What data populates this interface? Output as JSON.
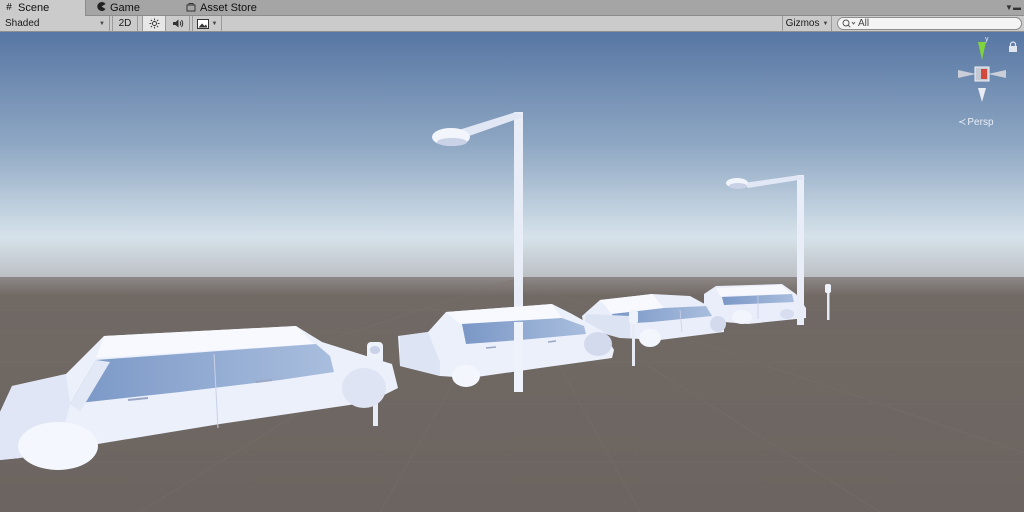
{
  "tabs": [
    {
      "label": "Scene",
      "icon": "grid-icon"
    },
    {
      "label": "Game",
      "icon": "pacman-icon"
    },
    {
      "label": "Asset Store",
      "icon": "store-icon"
    }
  ],
  "toolbar": {
    "draw_mode": "Shaded",
    "mode_2d": "2D",
    "lighting_icon": "sun-icon",
    "audio_icon": "speaker-icon",
    "effects_icon": "image-icon",
    "gizmos": "Gizmos",
    "search_value": "All",
    "search_icon": "search-icon"
  },
  "scene": {
    "projection_label": "Persp",
    "gizmo_axis_y_color": "#7fd33d",
    "gizmo_axis_x_color": "#d34a3d",
    "sky_top": "#5a7aa6",
    "sky_horizon": "#dbe6ee",
    "ground": "#6f6763",
    "objects": [
      {
        "type": "car",
        "name": "station-wagon-front"
      },
      {
        "type": "parking-meter",
        "name": "meter-1"
      },
      {
        "type": "car",
        "name": "hatchback-middle"
      },
      {
        "type": "street-lamp",
        "name": "lamp-1"
      },
      {
        "type": "car",
        "name": "sedan-back"
      },
      {
        "type": "parking-meter",
        "name": "meter-2"
      },
      {
        "type": "car",
        "name": "wagon-far"
      },
      {
        "type": "street-lamp",
        "name": "lamp-2"
      },
      {
        "type": "parking-meter",
        "name": "meter-3"
      }
    ]
  }
}
